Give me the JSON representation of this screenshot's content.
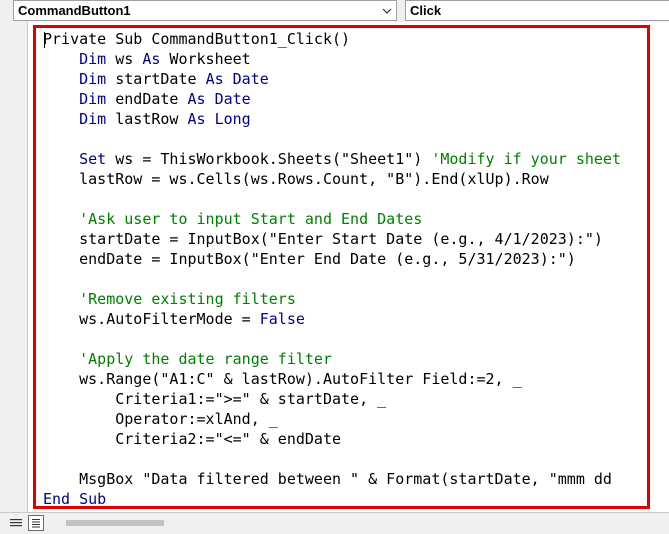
{
  "toolbar": {
    "object_combo": "CommandButton1",
    "procedure_combo": "Click"
  },
  "code_lines": [
    [
      {
        "t": "Private Sub CommandButton1_Click()",
        "c": "kw0"
      }
    ],
    [
      {
        "t": "    "
      },
      {
        "t": "Dim",
        "c": "kw"
      },
      {
        "t": " ws "
      },
      {
        "t": "As",
        "c": "kw"
      },
      {
        "t": " Worksheet"
      }
    ],
    [
      {
        "t": "    "
      },
      {
        "t": "Dim",
        "c": "kw"
      },
      {
        "t": " startDate "
      },
      {
        "t": "As",
        "c": "kw"
      },
      {
        "t": " "
      },
      {
        "t": "Date",
        "c": "kw"
      }
    ],
    [
      {
        "t": "    "
      },
      {
        "t": "Dim",
        "c": "kw"
      },
      {
        "t": " endDate "
      },
      {
        "t": "As",
        "c": "kw"
      },
      {
        "t": " "
      },
      {
        "t": "Date",
        "c": "kw"
      }
    ],
    [
      {
        "t": "    "
      },
      {
        "t": "Dim",
        "c": "kw"
      },
      {
        "t": " lastRow "
      },
      {
        "t": "As",
        "c": "kw"
      },
      {
        "t": " "
      },
      {
        "t": "Long",
        "c": "kw"
      }
    ],
    [],
    [
      {
        "t": "    "
      },
      {
        "t": "Set",
        "c": "kw"
      },
      {
        "t": " ws = ThisWorkbook.Sheets(\"Sheet1\") "
      },
      {
        "t": "'Modify if your sheet",
        "c": "cm"
      }
    ],
    [
      {
        "t": "    lastRow = ws.Cells(ws.Rows.Count, \"B\").End(xlUp).Row"
      }
    ],
    [],
    [
      {
        "t": "    "
      },
      {
        "t": "'Ask user to input Start and End Dates",
        "c": "cm"
      }
    ],
    [
      {
        "t": "    startDate = InputBox(\"Enter Start Date (e.g., 4/1/2023):\")"
      }
    ],
    [
      {
        "t": "    endDate = InputBox(\"Enter End Date (e.g., 5/31/2023):\")"
      }
    ],
    [],
    [
      {
        "t": "    "
      },
      {
        "t": "'Remove existing filters",
        "c": "cm"
      }
    ],
    [
      {
        "t": "    ws.AutoFilterMode = "
      },
      {
        "t": "False",
        "c": "kw"
      }
    ],
    [],
    [
      {
        "t": "    "
      },
      {
        "t": "'Apply the date range filter",
        "c": "cm"
      }
    ],
    [
      {
        "t": "    ws.Range(\"A1:C\" & lastRow).AutoFilter Field:=2, _"
      }
    ],
    [
      {
        "t": "        Criteria1:=\">=\" & startDate, _"
      }
    ],
    [
      {
        "t": "        Operator:=xlAnd, _"
      }
    ],
    [
      {
        "t": "        Criteria2:=\"<=\" & endDate"
      }
    ],
    [],
    [
      {
        "t": "    MsgBox \"Data filtered between \" & Format(startDate, \"mmm dd"
      }
    ],
    [
      {
        "t": "End Sub",
        "c": "kw"
      }
    ]
  ],
  "colors": {
    "keyword": "#00008b",
    "comment": "#008000",
    "highlight_border": "#e00000"
  },
  "icons": {
    "dropdown": "chevron-down-icon",
    "procedure_view": "procedure-view-icon",
    "full_module_view": "full-module-view-icon"
  }
}
